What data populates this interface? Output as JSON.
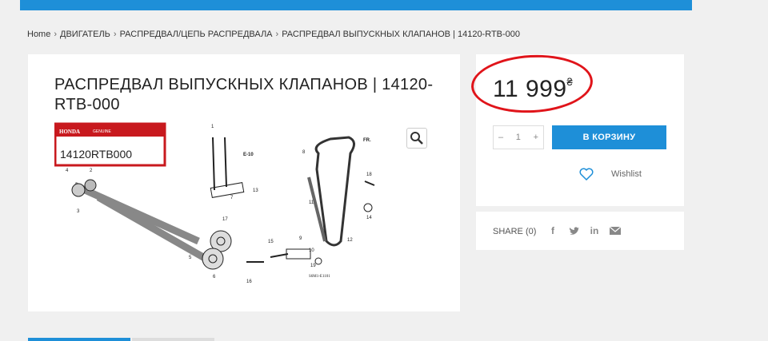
{
  "breadcrumb": {
    "home": "Home",
    "items": [
      "ДВИГАТЕЛЬ",
      "РАСПРЕДВАЛ/ЦЕПЬ РАСПРЕДВАЛА",
      "РАСПРЕДВАЛ ВЫПУСКНЫХ КЛАПАНОВ | 14120-RTB-000"
    ]
  },
  "product": {
    "title": "РАСПРЕДВАЛ ВЫПУСКНЫХ КЛАПАНОВ | 14120-RTB-000",
    "badge_brand": "HONDA",
    "badge_label": "GENUINE",
    "part_number": "14120RTB000",
    "diagram_code": "S6M1-E1101",
    "diagram_ref": "E-10",
    "diagram_arrow": "FR."
  },
  "price": {
    "amount": "11 999",
    "currency": "₴",
    "highlight_color": "#e0141a"
  },
  "cart": {
    "qty_minus": "–",
    "qty_value": "1",
    "qty_plus": "+",
    "button_label": "В КОРЗИНУ",
    "wishlist_label": "Wishlist"
  },
  "share": {
    "label": "SHARE (0)",
    "icons": [
      "facebook-icon",
      "twitter-icon",
      "linkedin-icon",
      "email-icon"
    ]
  },
  "colors": {
    "accent": "#1e8fd8"
  }
}
